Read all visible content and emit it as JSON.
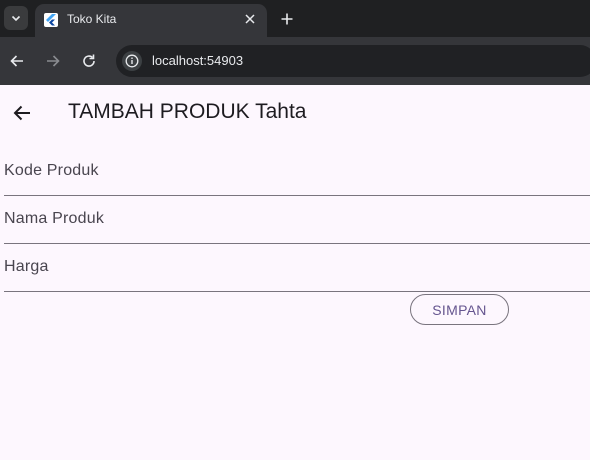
{
  "browser": {
    "tab_title": "Toko Kita",
    "url": "localhost:54903"
  },
  "appbar": {
    "title": "TAMBAH PRODUK Tahta"
  },
  "form": {
    "fields": [
      {
        "label": "Kode Produk",
        "value": ""
      },
      {
        "label": "Nama Produk",
        "value": ""
      },
      {
        "label": "Harga",
        "value": ""
      }
    ],
    "submit_label": "SIMPAN"
  },
  "colors": {
    "background": "#fdf7fe",
    "accent": "#65558f",
    "outline": "#79747e"
  },
  "icons": [
    "chevron-down-icon",
    "flutter-icon",
    "close-icon",
    "plus-icon",
    "arrow-back-icon",
    "arrow-forward-icon",
    "reload-icon",
    "info-icon"
  ]
}
